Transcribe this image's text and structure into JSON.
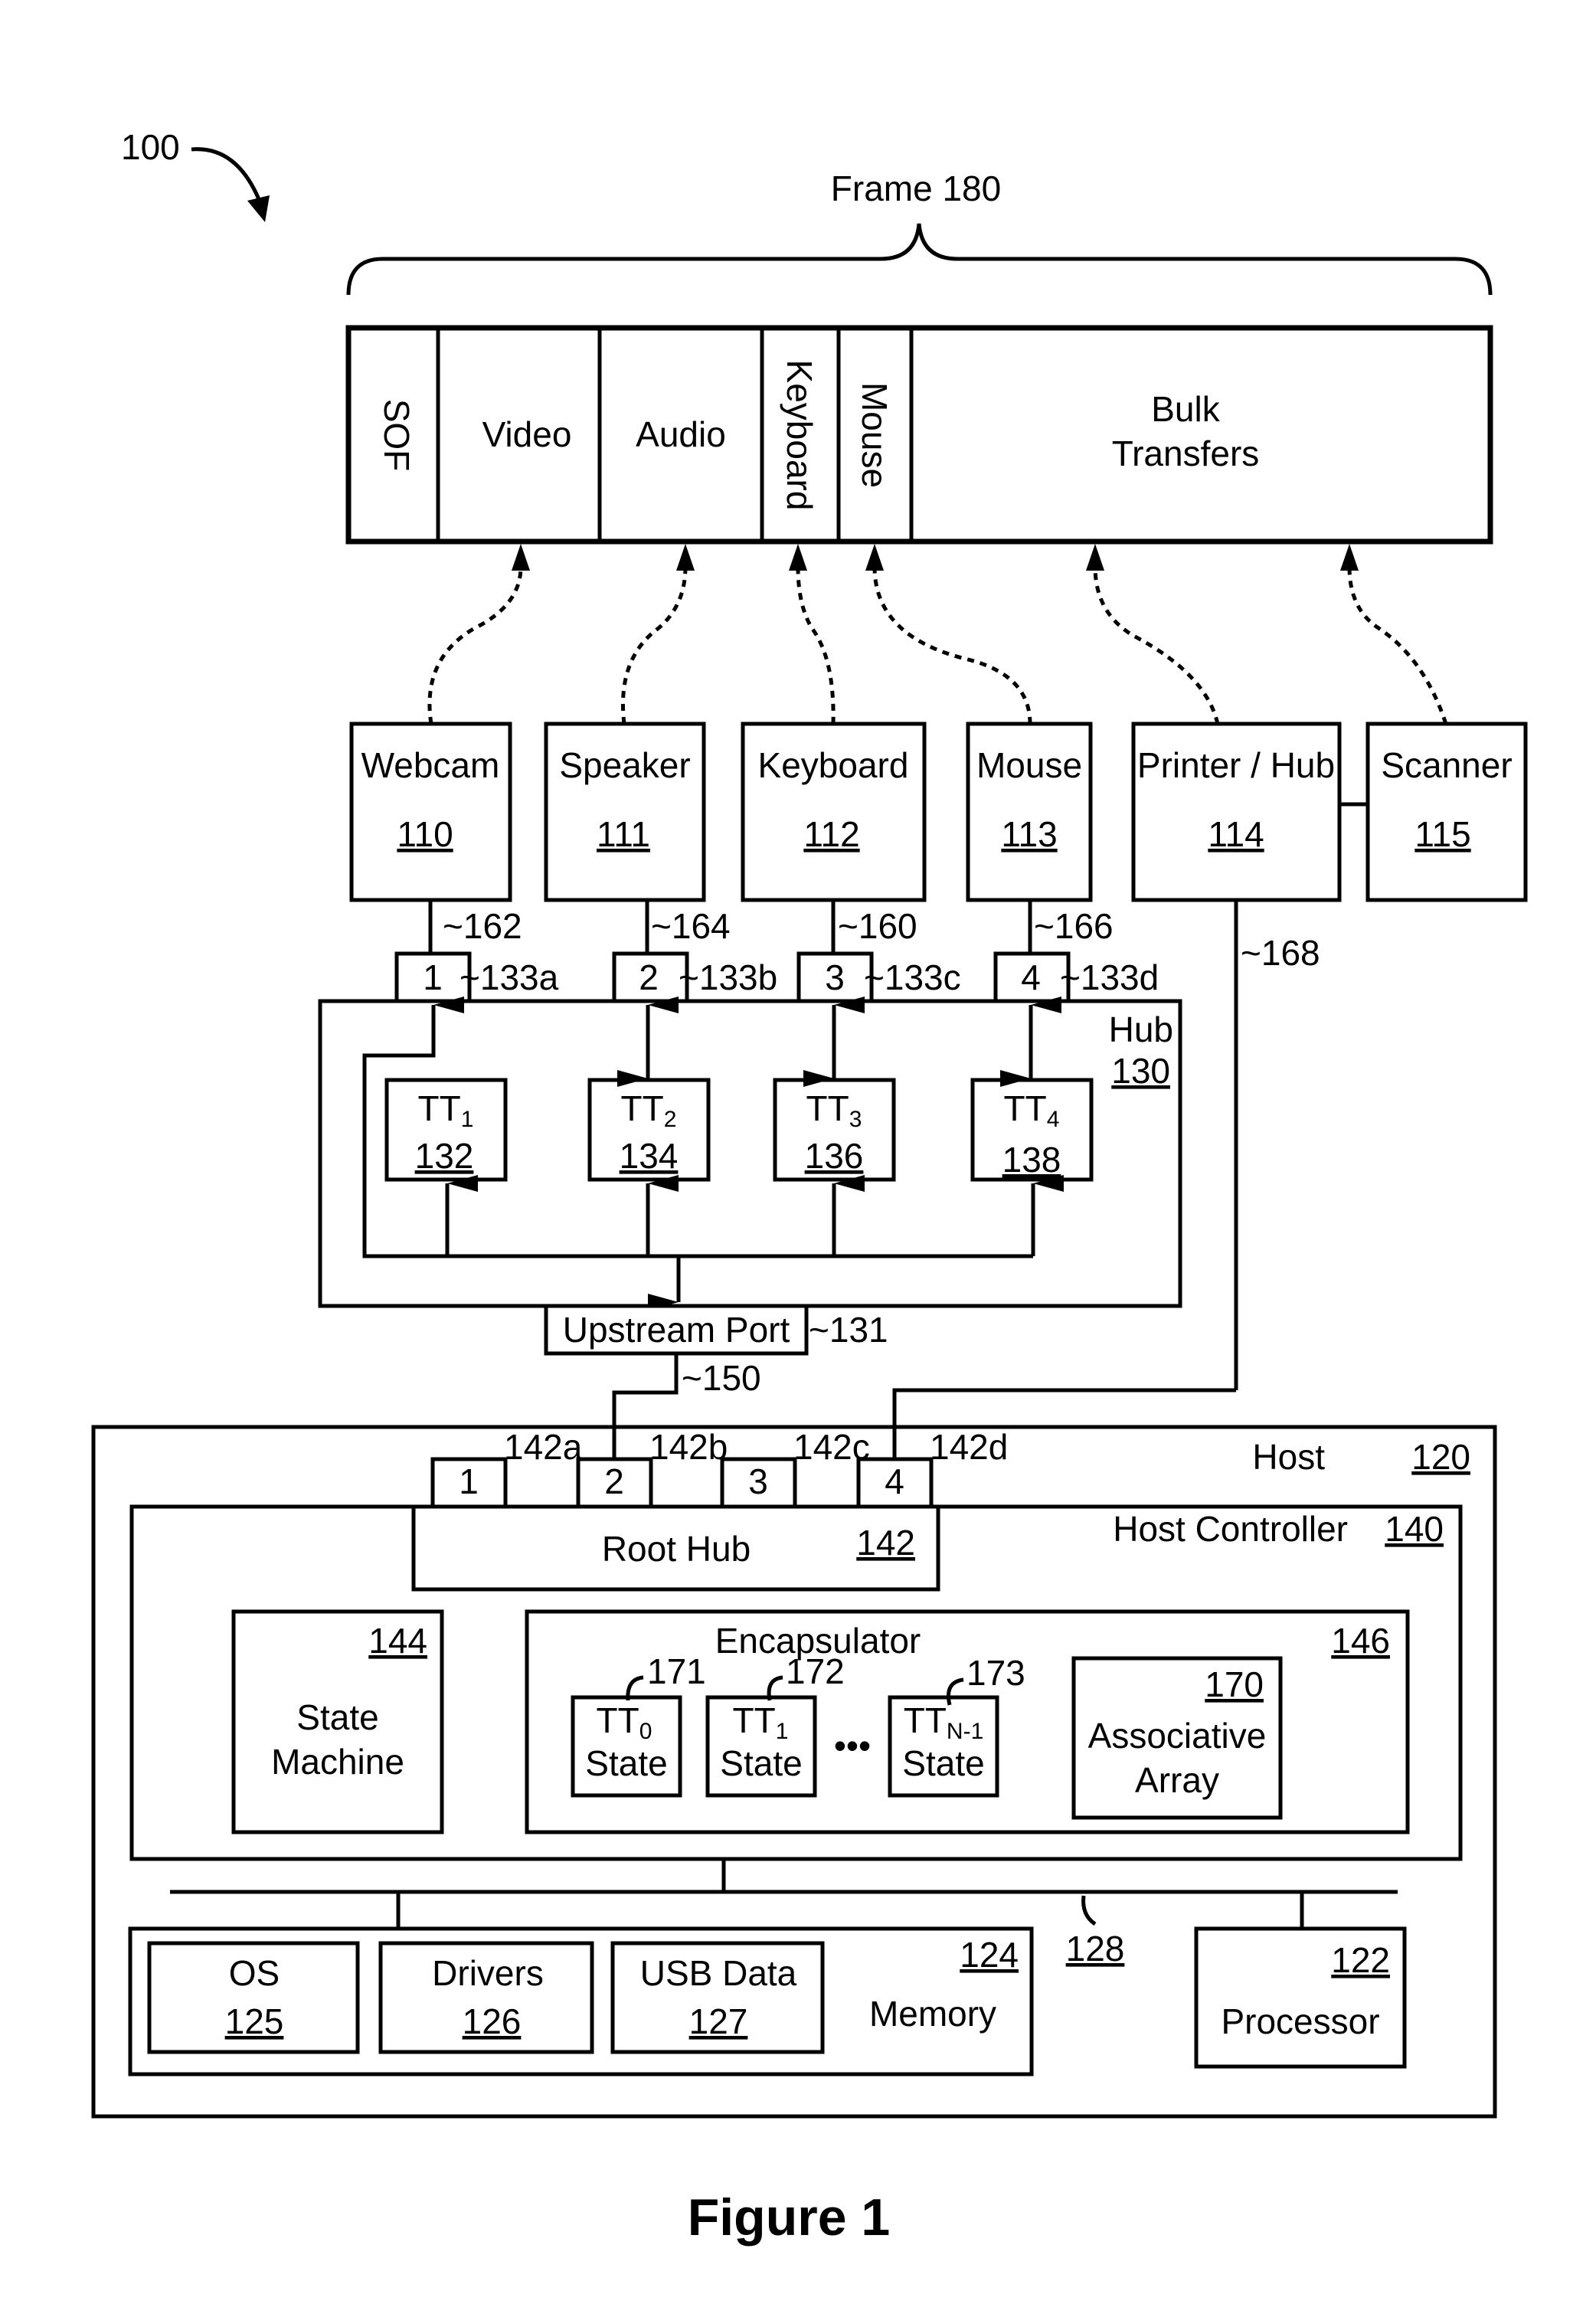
{
  "diagram": {
    "ref_main": "100",
    "figure_caption": "Figure 1",
    "frame": {
      "label": "Frame 180",
      "segments": [
        "SOF",
        "Video",
        "Audio",
        "Keyboard",
        "Mouse",
        "Bulk",
        "Transfers"
      ]
    },
    "devices": [
      {
        "name": "Webcam",
        "ref": "110",
        "link": "162",
        "port": "1",
        "port_ref": "133a"
      },
      {
        "name": "Speaker",
        "ref": "111",
        "link": "164",
        "port": "2",
        "port_ref": "133b"
      },
      {
        "name": "Keyboard",
        "ref": "112",
        "link": "160",
        "port": "3",
        "port_ref": "133c"
      },
      {
        "name": "Mouse",
        "ref": "113",
        "link": "166",
        "port": "4",
        "port_ref": "133d"
      },
      {
        "name": "Printer / Hub",
        "ref": "114",
        "link": "168"
      },
      {
        "name": "Scanner",
        "ref": "115"
      }
    ],
    "hub": {
      "label": "Hub",
      "ref": "130",
      "tts": [
        {
          "name": "TT",
          "sub": "1",
          "ref": "132"
        },
        {
          "name": "TT",
          "sub": "2",
          "ref": "134"
        },
        {
          "name": "TT",
          "sub": "3",
          "ref": "136"
        },
        {
          "name": "TT",
          "sub": "4",
          "ref": "138"
        }
      ],
      "upstream_port": "Upstream Port",
      "upstream_ref": "131",
      "uplink_ref": "150"
    },
    "host": {
      "label": "Host",
      "ref": "120",
      "root_ports": [
        {
          "num": "1",
          "ref": "142a"
        },
        {
          "num": "2",
          "ref": "142b"
        },
        {
          "num": "3",
          "ref": "142c"
        },
        {
          "num": "4",
          "ref": "142d"
        }
      ],
      "controller": {
        "label": "Host Controller",
        "ref": "140"
      },
      "root_hub": {
        "label": "Root Hub",
        "ref": "142"
      },
      "state_machine": {
        "label1": "State",
        "label2": "Machine",
        "ref": "144"
      },
      "encapsulator": {
        "label": "Encapsulator",
        "ref": "146",
        "states": [
          {
            "name": "TT",
            "sub": "0",
            "label": "State",
            "ref": "171"
          },
          {
            "name": "TT",
            "sub": "1",
            "label": "State",
            "ref": "172"
          },
          {
            "name": "TT",
            "sub": "N-1",
            "label": "State",
            "ref": "173"
          }
        ],
        "ellipsis": "•••",
        "assoc": {
          "label1": "Associative",
          "label2": "Array",
          "ref": "170"
        }
      },
      "bus_ref": "128",
      "memory": {
        "label": "Memory",
        "ref": "124",
        "items": [
          {
            "name": "OS",
            "ref": "125"
          },
          {
            "name": "Drivers",
            "ref": "126"
          },
          {
            "name": "USB Data",
            "ref": "127"
          }
        ]
      },
      "processor": {
        "label": "Processor",
        "ref": "122"
      }
    }
  }
}
